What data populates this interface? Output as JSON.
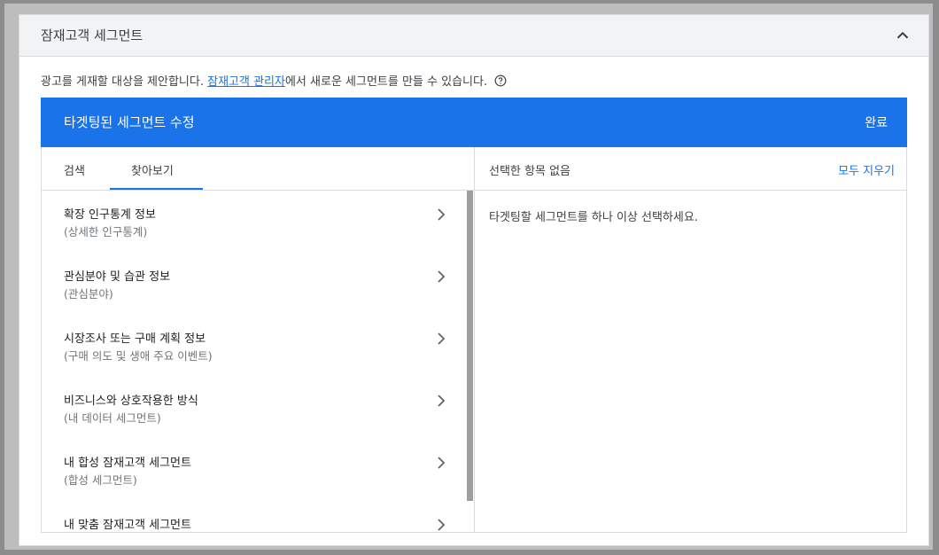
{
  "card": {
    "title": "잠재고객 세그먼트",
    "description_prefix": "광고를 게재할 대상을 제안합니다. ",
    "description_link": "잠재고객 관리자",
    "description_suffix": "에서 새로운 세그먼트를 만들 수 있습니다."
  },
  "editor": {
    "title": "타겟팅된 세그먼트 수정",
    "done_label": "완료",
    "tabs": [
      {
        "label": "검색",
        "active": false
      },
      {
        "label": "찾아보기",
        "active": true
      }
    ],
    "items": [
      {
        "title": "확장 인구통계 정보",
        "subtitle": "(상세한 인구통계)"
      },
      {
        "title": "관심분야 및 습관 정보",
        "subtitle": "(관심분야)"
      },
      {
        "title": "시장조사 또는 구매 계획 정보",
        "subtitle": "(구매 의도 및 생애 주요 이벤트)"
      },
      {
        "title": "비즈니스와 상호작용한 방식",
        "subtitle": "(내 데이터 세그먼트)"
      },
      {
        "title": "내 합성 잠재고객 세그먼트",
        "subtitle": "(합성 세그먼트)"
      },
      {
        "title": "내 맞춤 잠재고객 세그먼트",
        "subtitle": ""
      }
    ],
    "selected_header": "선택한 항목 없음",
    "clear_all_label": "모두 지우기",
    "empty_hint": "타겟팅할 세그먼트를 하나 이상 선택하세요."
  },
  "colors": {
    "accent": "#1a73e8",
    "header_bg": "#f1f3f4"
  }
}
